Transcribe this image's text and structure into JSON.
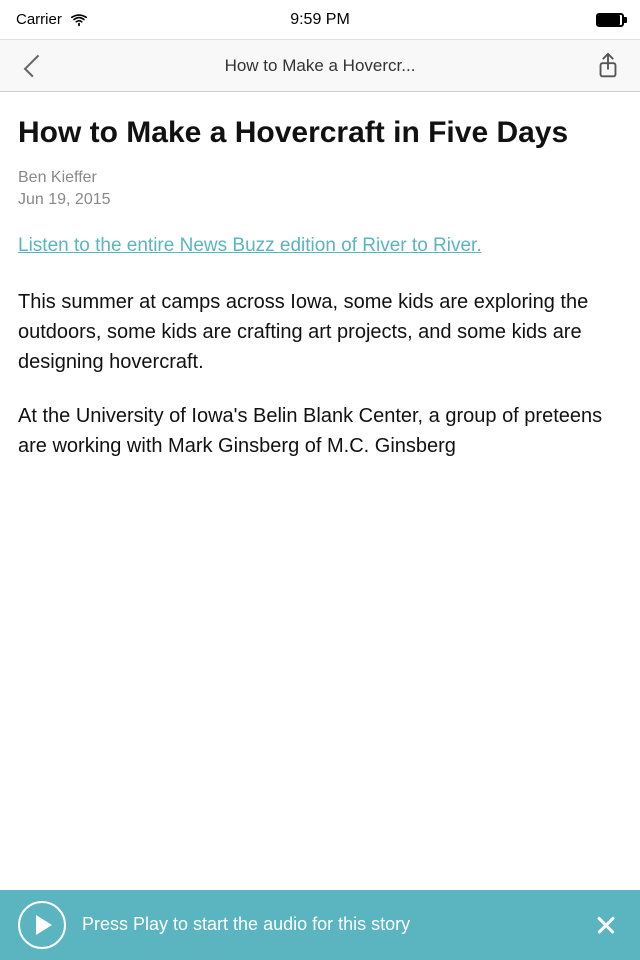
{
  "status_bar": {
    "carrier": "Carrier",
    "time": "9:59 PM"
  },
  "nav": {
    "title": "How to Make a Hovercr...",
    "back_label": "back",
    "share_label": "share"
  },
  "article": {
    "title": "How to Make a Hovercraft in Five Days",
    "author": "Ben Kieffer",
    "date": "Jun 19, 2015",
    "link_text": "Listen to the entire News Buzz edition of River to River.",
    "body_paragraph1": "This summer at camps across Iowa, some kids are exploring the outdoors, some kids are crafting art projects, and some kids are designing hovercraft.",
    "body_paragraph2": "At the University of Iowa's Belin Blank Center, a group of preteens are working with Mark Ginsberg of M.C. Ginsberg"
  },
  "audio_bar": {
    "play_label": "play",
    "text": "Press Play to start the audio for this story",
    "close_label": "close"
  }
}
